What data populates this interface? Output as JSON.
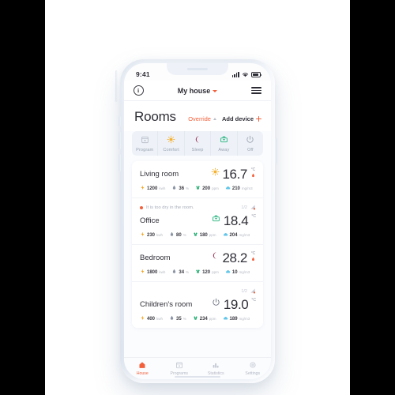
{
  "status_bar": {
    "time": "9:41",
    "signal_icon": "signal-bars-icon",
    "wifi_icon": "wifi-icon",
    "battery_icon": "battery-icon"
  },
  "app_bar": {
    "info_label": "i",
    "title": "My house",
    "chevron_icon": "chevron-down-icon",
    "menu_icon": "hamburger-menu-icon"
  },
  "page": {
    "title": "Rooms",
    "override_label": "Override",
    "override_chevron_icon": "chevron-up-icon",
    "add_device_label": "Add device",
    "add_device_icon": "plus-icon"
  },
  "modes": [
    {
      "label": "Program",
      "icon": "calendar-icon",
      "glyph": "Ὕ3",
      "color": "#b9bfca"
    },
    {
      "label": "Comfort",
      "icon": "sun-icon",
      "glyph": "☀",
      "color": "#f5b335"
    },
    {
      "label": "Sleep",
      "icon": "moon-icon",
      "glyph": "☾",
      "color": "#9b3a5e"
    },
    {
      "label": "Away",
      "icon": "briefcase-icon",
      "glyph": "▭",
      "color": "#26b47f"
    },
    {
      "label": "Off",
      "icon": "power-icon",
      "glyph": "⏻",
      "color": "#9aa3b0"
    }
  ],
  "rooms": [
    {
      "name": "Living room",
      "temperature": "16.7",
      "unit": "°C",
      "mode_icon": "sun-icon",
      "mode_glyph": "☀",
      "mode_color": "#f5b335",
      "heating_icon": "flame-icon",
      "alert": null,
      "stats": [
        {
          "icon": "lightning-icon",
          "glyph": "⚡",
          "color": "#f5a623",
          "value": "1200",
          "unit": "kwh"
        },
        {
          "icon": "humidity-drop-icon",
          "glyph": "⬤",
          "color": "#8a94a3",
          "value": "36",
          "unit": "%"
        },
        {
          "icon": "co2-icon",
          "glyph": "☘",
          "color": "#16a96a",
          "value": "200",
          "unit": "ppm"
        },
        {
          "icon": "cloud-icon",
          "glyph": "☁",
          "color": "#63c6e8",
          "value": "210",
          "unit": "mg/m3"
        }
      ]
    },
    {
      "name": "Office",
      "temperature": "18.4",
      "unit": "°C",
      "mode_icon": "briefcase-icon",
      "mode_glyph": "▭",
      "mode_color": "#26b47f",
      "heating_icon": null,
      "alert": {
        "text": "It is too dry in the room.",
        "dot_color": "#f2603c",
        "fraction": "1/2",
        "signal_icon": "sensor-signal-icon"
      },
      "stats": [
        {
          "icon": "lightning-icon",
          "glyph": "⚡",
          "color": "#f5a623",
          "value": "230",
          "unit": "kwh"
        },
        {
          "icon": "humidity-drop-icon",
          "glyph": "⬤",
          "color": "#8a94a3",
          "value": "80",
          "unit": "%"
        },
        {
          "icon": "co2-icon",
          "glyph": "☘",
          "color": "#16a96a",
          "value": "180",
          "unit": "ppm"
        },
        {
          "icon": "cloud-icon",
          "glyph": "☁",
          "color": "#63c6e8",
          "value": "204",
          "unit": "mg/m3"
        }
      ]
    },
    {
      "name": "Bedroom",
      "temperature": "28.2",
      "unit": "°C",
      "mode_icon": "moon-icon",
      "mode_glyph": "☾",
      "mode_color": "#9b3a5e",
      "heating_icon": "flame-icon",
      "alert": null,
      "stats": [
        {
          "icon": "lightning-icon",
          "glyph": "⚡",
          "color": "#f5a623",
          "value": "1800",
          "unit": "kwh"
        },
        {
          "icon": "humidity-drop-icon",
          "glyph": "⬤",
          "color": "#8a94a3",
          "value": "34",
          "unit": "%"
        },
        {
          "icon": "co2-icon",
          "glyph": "☘",
          "color": "#16a96a",
          "value": "120",
          "unit": "ppm"
        },
        {
          "icon": "cloud-icon",
          "glyph": "☁",
          "color": "#63c6e8",
          "value": "10",
          "unit": "mg/m3"
        }
      ]
    },
    {
      "name": "Children's room",
      "temperature": "19.0",
      "unit": "°C",
      "mode_icon": "power-icon",
      "mode_glyph": "⏻",
      "mode_color": "#6b7280",
      "heating_icon": null,
      "alert": {
        "text": "",
        "dot_color": "transparent",
        "fraction": "1/2",
        "signal_icon": "sensor-signal-icon"
      },
      "stats": [
        {
          "icon": "lightning-icon",
          "glyph": "⚡",
          "color": "#f5a623",
          "value": "400",
          "unit": "kwh"
        },
        {
          "icon": "humidity-drop-icon",
          "glyph": "⬤",
          "color": "#8a94a3",
          "value": "35",
          "unit": "%"
        },
        {
          "icon": "co2-icon",
          "glyph": "☘",
          "color": "#16a96a",
          "value": "234",
          "unit": "ppm"
        },
        {
          "icon": "cloud-icon",
          "glyph": "☁",
          "color": "#63c6e8",
          "value": "189",
          "unit": "mg/m3"
        }
      ]
    }
  ],
  "tabs": [
    {
      "label": "House",
      "icon": "home-icon",
      "glyph": "⌂",
      "active": true
    },
    {
      "label": "Programs",
      "icon": "calendar-icon",
      "glyph": "Ὕ3",
      "active": false
    },
    {
      "label": "Statistics",
      "icon": "bar-chart-icon",
      "glyph": "ὌA",
      "active": false
    },
    {
      "label": "Settings",
      "icon": "gear-icon",
      "glyph": "⚙",
      "active": false
    }
  ],
  "theme": {
    "accent": "#f2603c",
    "text": "#2f2f38",
    "muted": "#b3b9c4",
    "panel": "#eef2f8"
  }
}
